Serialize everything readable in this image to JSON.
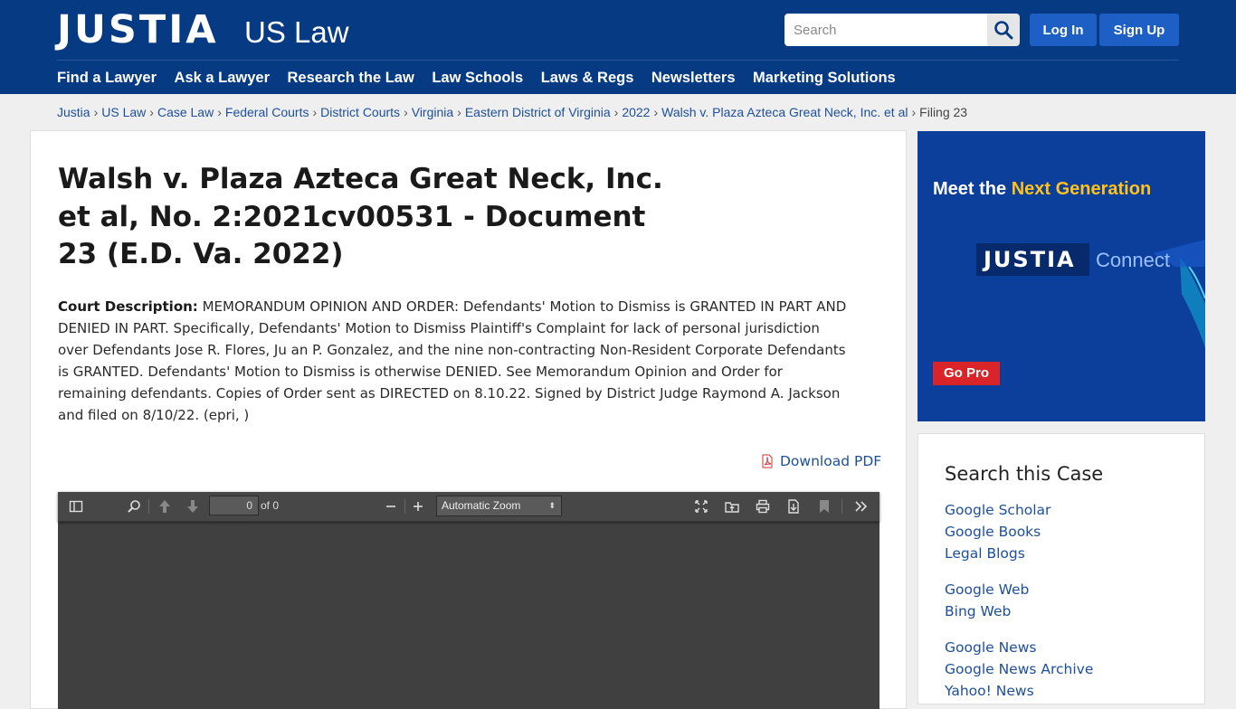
{
  "header": {
    "logo": "JUSTIA",
    "logo_sub": "US Law",
    "search_placeholder": "Search",
    "login_label": "Log In",
    "signup_label": "Sign Up",
    "nav": [
      "Find a Lawyer",
      "Ask a Lawyer",
      "Research the Law",
      "Law Schools",
      "Laws & Regs",
      "Newsletters",
      "Marketing Solutions"
    ]
  },
  "breadcrumb": {
    "items": [
      "Justia",
      "US Law",
      "Case Law",
      "Federal Courts",
      "District Courts",
      "Virginia",
      "Eastern District of Virginia",
      "2022",
      "Walsh v. Plaza Azteca Great Neck, Inc. et al"
    ],
    "current": "Filing 23",
    "separator": "›"
  },
  "document": {
    "title": "Walsh v. Plaza Azteca Great Neck, Inc. et al, No. 2:2021cv00531 - Document 23 (E.D. Va. 2022)",
    "description_label": "Court Description:",
    "description": "MEMORANDUM OPINION AND ORDER: Defendants' Motion to Dismiss is GRANTED IN PART AND DENIED IN PART. Specifically, Defendants' Motion to Dismiss Plaintiff's Complaint for lack of personal jurisdiction over Defendants Jose R. Flores, Ju an P. Gonzalez, and the nine non-contracting Non-Resident Corporate Defendants is GRANTED. Defendants' Motion to Dismiss is otherwise DENIED. See Memorandum Opinion and Order for remaining defendants. Copies of Order sent as DIRECTED on 8.10.22. Signed by District Judge Raymond A. Jackson and filed on 8/10/22. (epri, )",
    "download_label": "Download PDF"
  },
  "pdf_viewer": {
    "page_value": "0",
    "page_of": "of 0",
    "zoom_label": "Automatic Zoom"
  },
  "ad": {
    "title_prefix": "Meet the ",
    "title_highlight": "Next Generation",
    "logo": "JUSTIA",
    "connect": "Connect",
    "button_label": "Go Pro"
  },
  "sidebar": {
    "title": "Search this Case",
    "links": [
      "Google Scholar",
      "Google Books",
      "Legal Blogs",
      "Google Web",
      "Bing Web",
      "Google News",
      "Google News Archive",
      "Yahoo! News"
    ]
  },
  "colors": {
    "header_bg": "#063a83",
    "button_bg": "#1d5fc4",
    "link": "#1d4f9a",
    "ad_bg": "#0c3f9c",
    "ad_highlight": "#ffc21a",
    "go_pro": "#d9252a",
    "viewer_bg": "#404040"
  }
}
